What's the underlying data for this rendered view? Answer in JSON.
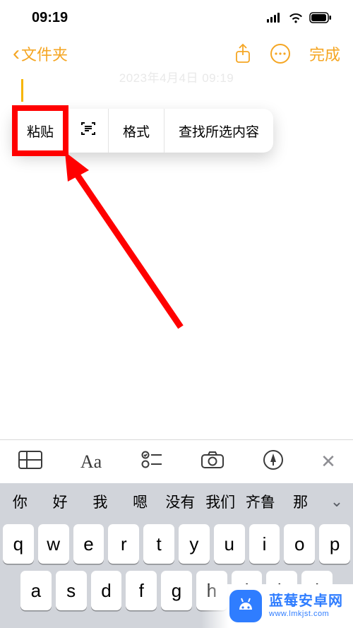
{
  "status": {
    "time": "09:19"
  },
  "nav": {
    "back_label": "文件夹",
    "done_label": "完成"
  },
  "note": {
    "date": "2023年4月4日 09:19"
  },
  "popover": {
    "paste": "粘贴",
    "format": "格式",
    "find": "查找所选内容"
  },
  "candidates": {
    "items": [
      "你",
      "好",
      "我",
      "嗯",
      "没有",
      "我们",
      "齐鲁",
      "那"
    ]
  },
  "keyboard": {
    "row1": [
      "q",
      "w",
      "e",
      "r",
      "t",
      "y",
      "u",
      "i",
      "o",
      "p"
    ],
    "row2": [
      "a",
      "s",
      "d",
      "f",
      "g",
      "h",
      "j",
      "k",
      "l"
    ]
  },
  "watermark": {
    "title": "蓝莓安卓网",
    "url": "www.lmkjst.com"
  }
}
